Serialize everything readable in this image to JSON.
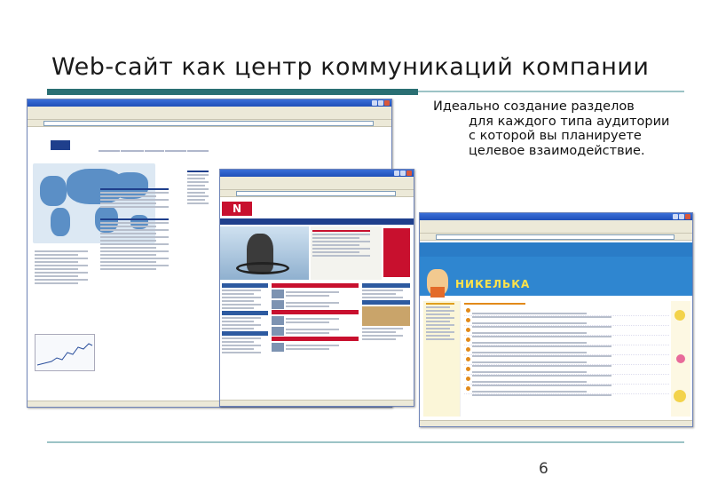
{
  "slide": {
    "title": "Web-сайт как центр коммуникаций компании",
    "description_lines": [
      "Идеально создание разделов",
      "для каждого типа аудитории",
      "с которой вы планируете",
      "целевое взаимодействие."
    ],
    "page_number": "6"
  },
  "colors": {
    "accent_rule": "#2a6f73",
    "accent_rule_light": "#9cc3c6",
    "browser_title": "#1f4fb8",
    "nornickel_blue": "#1f3f8c",
    "newspaper_red": "#c8102e",
    "nikelka_blue": "#2f86d0"
  },
  "screenshots": [
    {
      "name": "nornickel-site",
      "logo_icon": "nornickel-logo-icon",
      "map_icon": "world-map-icon"
    },
    {
      "name": "corporate-newspaper-site",
      "logo_icon": "newspaper-logo-icon",
      "photo_icon": "motocross-photo-icon"
    },
    {
      "name": "nikelka-kids-site",
      "logo_text": "НИКЕЛЬКА"
    }
  ]
}
